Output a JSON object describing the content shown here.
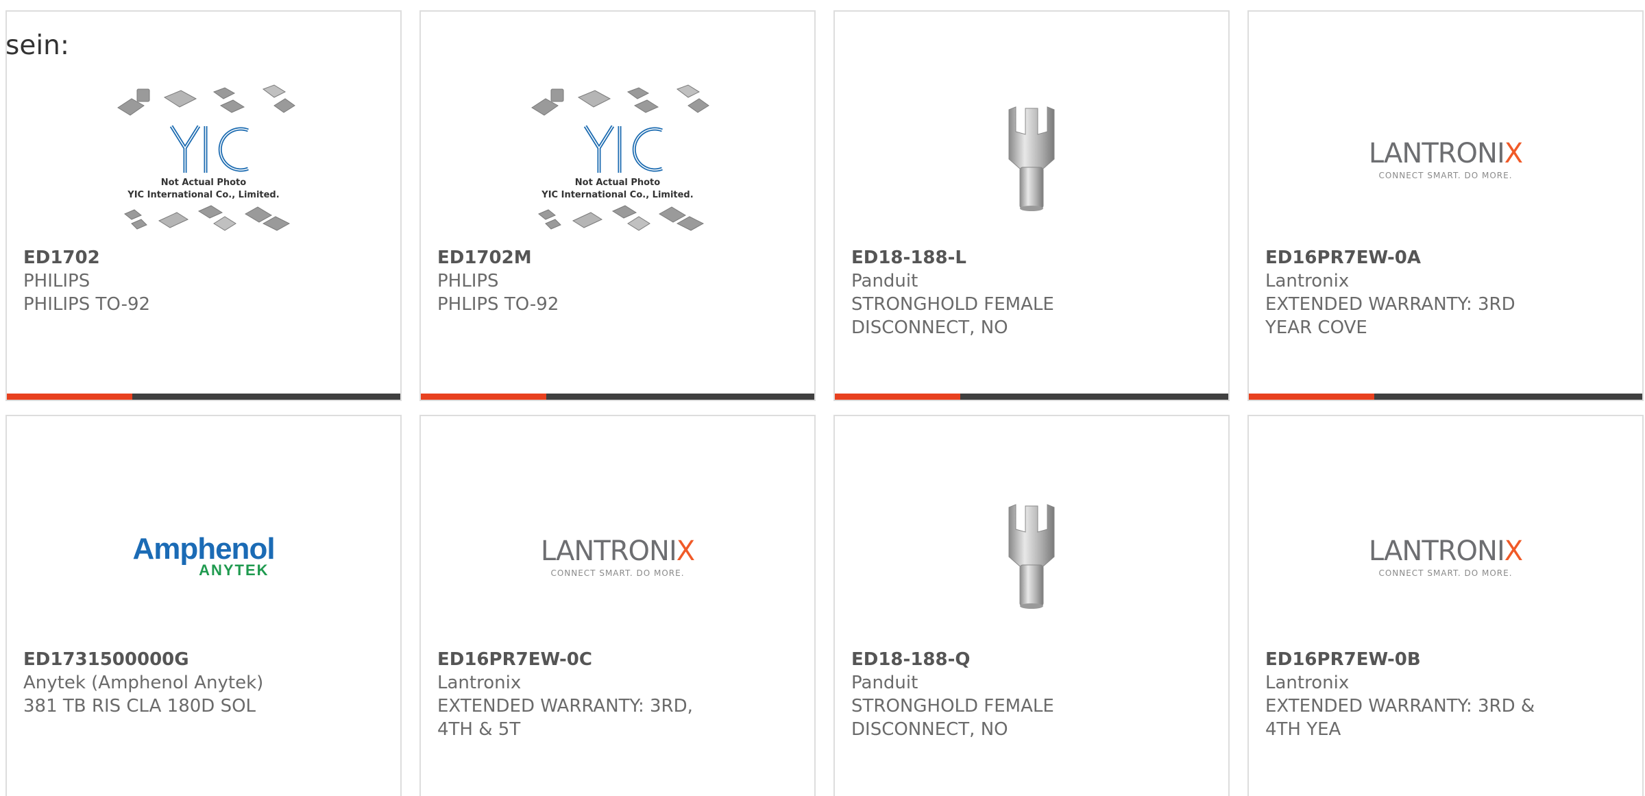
{
  "intro": {
    "text": "sein:"
  },
  "colors": {
    "accent": "#e8411f",
    "bar": "#404040",
    "border": "#dddddd"
  },
  "products": [
    {
      "part_number": "ED1702",
      "manufacturer": "PHILIPS",
      "description": "PHILIPS TO-92",
      "image": "yic-placeholder",
      "image_text": [
        "Not Actual Photo",
        "YIC International Co., Limited."
      ]
    },
    {
      "part_number": "ED1702M",
      "manufacturer": "PHLIPS",
      "description": "PHLIPS TO-92",
      "image": "yic-placeholder",
      "image_text": [
        "Not Actual Photo",
        "YIC International Co., Limited."
      ]
    },
    {
      "part_number": "ED18-188-L",
      "manufacturer": "Panduit",
      "description_lines": [
        "STRONGHOLD FEMALE",
        "DISCONNECT, NO"
      ],
      "image": "terminal-connector-photo"
    },
    {
      "part_number": "ED16PR7EW-0A",
      "manufacturer": "Lantronix",
      "description_lines": [
        "EXTENDED WARRANTY: 3RD",
        "YEAR COVE"
      ],
      "image": "lantronix-logo",
      "logo": {
        "name": "LANTRONIX",
        "tagline": "CONNECT SMART. DO MORE."
      }
    },
    {
      "part_number": "ED1731500000G",
      "manufacturer": "Anytek (Amphenol Anytek)",
      "description": "381 TB RIS CLA 180D SOL",
      "image": "amphenol-anytek-logo",
      "logo": {
        "name": "Amphenol",
        "sub": "ANYTEK"
      }
    },
    {
      "part_number": "ED16PR7EW-0C",
      "manufacturer": "Lantronix",
      "description_lines": [
        "EXTENDED WARRANTY: 3RD,",
        "4TH & 5T"
      ],
      "image": "lantronix-logo",
      "logo": {
        "name": "LANTRONIX",
        "tagline": "CONNECT SMART. DO MORE."
      }
    },
    {
      "part_number": "ED18-188-Q",
      "manufacturer": "Panduit",
      "description_lines": [
        "STRONGHOLD FEMALE",
        "DISCONNECT, NO"
      ],
      "image": "terminal-connector-photo"
    },
    {
      "part_number": "ED16PR7EW-0B",
      "manufacturer": "Lantronix",
      "description_lines": [
        "EXTENDED WARRANTY: 3RD &",
        "4TH YEA"
      ],
      "image": "lantronix-logo",
      "logo": {
        "name": "LANTRONIX",
        "tagline": "CONNECT SMART. DO MORE."
      }
    }
  ]
}
